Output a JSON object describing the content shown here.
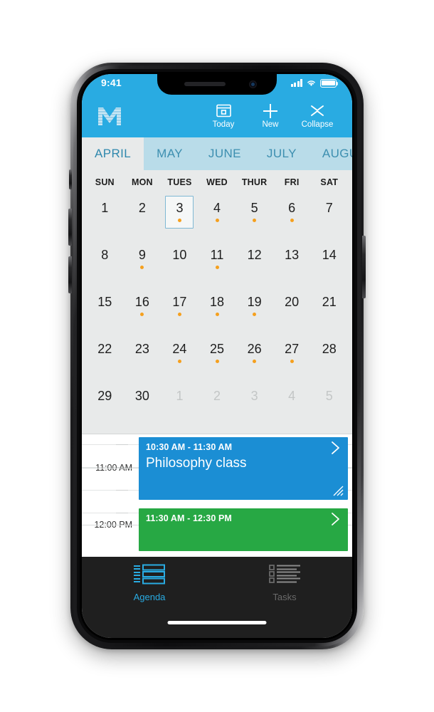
{
  "status_bar": {
    "time": "9:41",
    "icons": [
      "signal-bars-icon",
      "wifi-icon",
      "battery-icon"
    ]
  },
  "app_bar": {
    "logo": "M",
    "actions": [
      {
        "label": "Today",
        "icon": "today-window-icon"
      },
      {
        "label": "New",
        "icon": "plus-icon"
      },
      {
        "label": "Collapse",
        "icon": "collapse-chevrons-icon"
      }
    ]
  },
  "month_strip": {
    "selected": "APRIL",
    "months": [
      "APRIL",
      "MAY",
      "JUNE",
      "JULY",
      "AUGUST"
    ]
  },
  "calendar": {
    "weekday_headers": [
      "SUN",
      "MON",
      "TUES",
      "WED",
      "THUR",
      "FRI",
      "SAT"
    ],
    "selected_day": 3,
    "weeks": [
      [
        {
          "num": "1",
          "dot": false,
          "muted": false
        },
        {
          "num": "2",
          "dot": false,
          "muted": false
        },
        {
          "num": "3",
          "dot": true,
          "muted": false
        },
        {
          "num": "4",
          "dot": true,
          "muted": false
        },
        {
          "num": "5",
          "dot": true,
          "muted": false
        },
        {
          "num": "6",
          "dot": true,
          "muted": false
        },
        {
          "num": "7",
          "dot": false,
          "muted": false
        }
      ],
      [
        {
          "num": "8",
          "dot": false,
          "muted": false
        },
        {
          "num": "9",
          "dot": true,
          "muted": false
        },
        {
          "num": "10",
          "dot": false,
          "muted": false
        },
        {
          "num": "11",
          "dot": true,
          "muted": false
        },
        {
          "num": "12",
          "dot": false,
          "muted": false
        },
        {
          "num": "13",
          "dot": false,
          "muted": false
        },
        {
          "num": "14",
          "dot": false,
          "muted": false
        }
      ],
      [
        {
          "num": "15",
          "dot": false,
          "muted": false
        },
        {
          "num": "16",
          "dot": true,
          "muted": false
        },
        {
          "num": "17",
          "dot": true,
          "muted": false
        },
        {
          "num": "18",
          "dot": true,
          "muted": false
        },
        {
          "num": "19",
          "dot": true,
          "muted": false
        },
        {
          "num": "20",
          "dot": false,
          "muted": false
        },
        {
          "num": "21",
          "dot": false,
          "muted": false
        }
      ],
      [
        {
          "num": "22",
          "dot": false,
          "muted": false
        },
        {
          "num": "23",
          "dot": false,
          "muted": false
        },
        {
          "num": "24",
          "dot": true,
          "muted": false
        },
        {
          "num": "25",
          "dot": true,
          "muted": false
        },
        {
          "num": "26",
          "dot": true,
          "muted": false
        },
        {
          "num": "27",
          "dot": true,
          "muted": false
        },
        {
          "num": "28",
          "dot": false,
          "muted": false
        }
      ],
      [
        {
          "num": "29",
          "dot": false,
          "muted": false
        },
        {
          "num": "30",
          "dot": false,
          "muted": false
        },
        {
          "num": "1",
          "dot": false,
          "muted": true
        },
        {
          "num": "2",
          "dot": false,
          "muted": true
        },
        {
          "num": "3",
          "dot": false,
          "muted": true
        },
        {
          "num": "4",
          "dot": false,
          "muted": true
        },
        {
          "num": "5",
          "dot": false,
          "muted": true
        }
      ]
    ],
    "dot_color": "#f5a01e",
    "selected_border_color": "#7fb8d4"
  },
  "agenda": {
    "hour_labels": [
      "11:00 AM",
      "12:00 PM"
    ],
    "events": [
      {
        "time": "10:30 AM - 11:30 AM",
        "title": "Philosophy class",
        "color": "#1b8ed4",
        "chevron": "chevron-right-icon",
        "grip": "resize-grip-icon"
      },
      {
        "time": "11:30 AM - 12:30 PM",
        "title": "",
        "color": "#27a844",
        "chevron": "chevron-right-icon",
        "grip": ""
      }
    ]
  },
  "tab_bar": {
    "tabs": [
      {
        "label": "Agenda",
        "icon": "agenda-list-icon",
        "active": true
      },
      {
        "label": "Tasks",
        "icon": "tasks-checklist-icon",
        "active": false
      }
    ],
    "active_color": "#29abe2",
    "inactive_color": "#6a6a6a"
  },
  "theme": {
    "brand_blue": "#29abe2",
    "month_strip_bg": "#b9dce9",
    "surface": "#e8eaea"
  }
}
